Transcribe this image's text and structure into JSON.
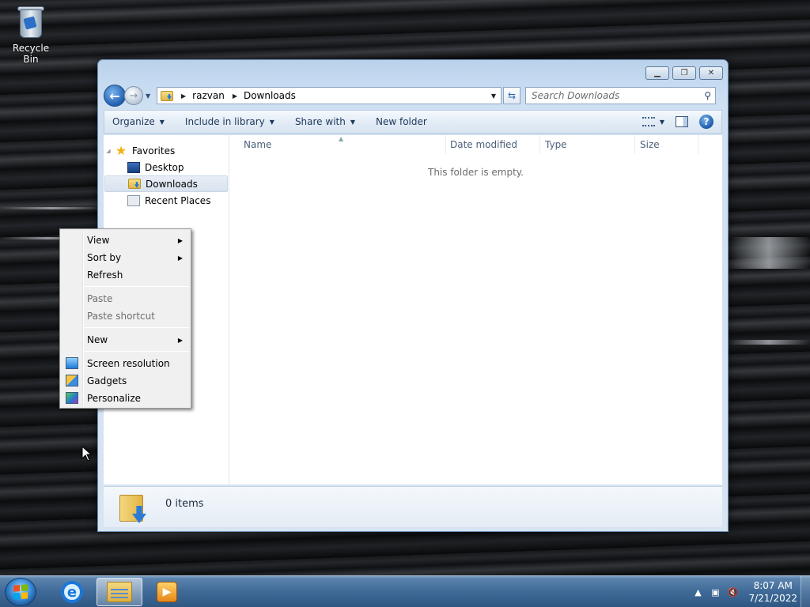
{
  "desktop": {
    "icons": [
      {
        "label": "Recycle Bin",
        "icon": "recycle-bin-icon"
      }
    ]
  },
  "window": {
    "address": {
      "crumbs": [
        "razvan",
        "Downloads"
      ]
    },
    "search": {
      "placeholder": "Search Downloads"
    },
    "toolbar": {
      "organize": "Organize",
      "include_in_library": "Include in library",
      "share_with": "Share with",
      "new_folder": "New folder"
    },
    "nav": {
      "favorites": "Favorites",
      "items": [
        {
          "label": "Desktop",
          "icon": "desktop-icon"
        },
        {
          "label": "Downloads",
          "icon": "downloads-folder-icon",
          "selected": true
        },
        {
          "label": "Recent Places",
          "icon": "recent-places-icon"
        }
      ]
    },
    "columns": [
      "Name",
      "Date modified",
      "Type",
      "Size"
    ],
    "empty_message": "This folder is empty.",
    "details": {
      "item_count": "0 items"
    }
  },
  "context_menu": {
    "items": [
      {
        "label": "View",
        "has_submenu": true,
        "disabled": false
      },
      {
        "label": "Sort by",
        "has_submenu": true,
        "disabled": false
      },
      {
        "label": "Refresh",
        "has_submenu": false,
        "disabled": false
      },
      {
        "label": "Paste",
        "has_submenu": false,
        "disabled": true
      },
      {
        "label": "Paste shortcut",
        "has_submenu": false,
        "disabled": true
      },
      {
        "label": "New",
        "has_submenu": true,
        "disabled": false
      },
      {
        "label": "Screen resolution",
        "icon": "screen-resolution-icon",
        "disabled": false
      },
      {
        "label": "Gadgets",
        "icon": "gadgets-icon",
        "disabled": false
      },
      {
        "label": "Personalize",
        "icon": "personalize-icon",
        "disabled": false
      }
    ]
  },
  "taskbar": {
    "pinned": [
      "internet-explorer-icon",
      "windows-explorer-icon",
      "media-player-icon"
    ],
    "clock": {
      "time": "8:07 AM",
      "date": "7/21/2022"
    }
  },
  "colors": {
    "taskbar": "#3f6a97",
    "accent": "#1f5fb0"
  }
}
